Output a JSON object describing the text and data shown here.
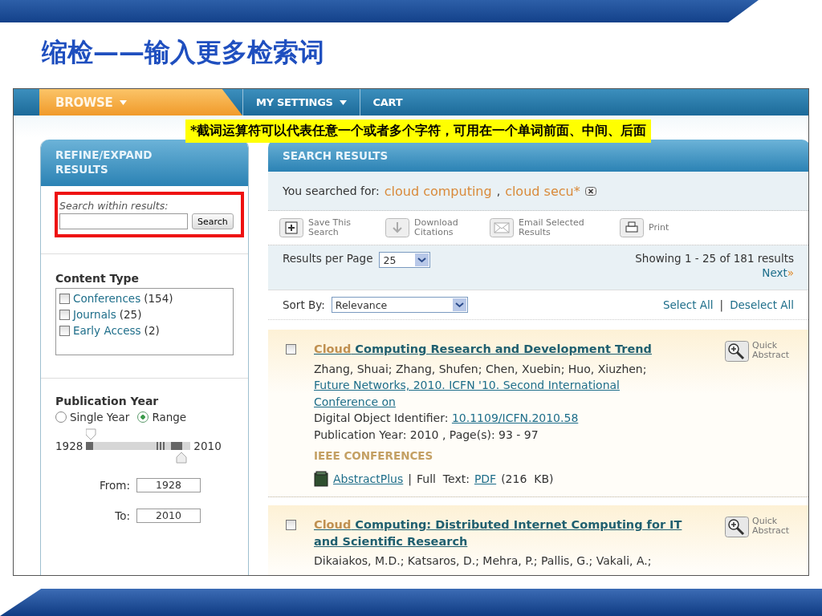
{
  "slide_title": "缩检——输入更多检索词",
  "nav": [
    {
      "label": "BROWSE",
      "selected": true,
      "caret": true
    },
    {
      "label": "MY SETTINGS",
      "selected": false,
      "caret": true
    },
    {
      "label": "CART",
      "selected": false,
      "caret": false
    }
  ],
  "callout": "*截词运算符可以代表任意一个或者多个字符，可用在一个单词前面、中间、后面",
  "refine": {
    "title": "REFINE/EXPAND RESULTS",
    "search_label": "Search within results:",
    "search_button": "Search",
    "highlighted": true
  },
  "content_type": {
    "heading": "Content Type",
    "items": [
      {
        "label": "Conferences",
        "count": "(154)",
        "checked": false
      },
      {
        "label": "Journals",
        "count": "(25)",
        "checked": false
      },
      {
        "label": "Early Access",
        "count": "(2)",
        "checked": false
      }
    ]
  },
  "publication_year": {
    "heading": "Publication Year",
    "modes": [
      {
        "label": "Single Year",
        "selected": false
      },
      {
        "label": "Range",
        "selected": true
      }
    ],
    "min": "1928",
    "max": "2010",
    "from_label": "From:",
    "from": "1928",
    "to_label": "To:",
    "to": "2010"
  },
  "results": {
    "title": "SEARCH RESULTS",
    "searched_label": "You searched for:",
    "terms": [
      "cloud computing",
      "cloud secu*"
    ],
    "term_separator": ",",
    "toolbar": [
      {
        "kind": "save",
        "label": "Save This Search"
      },
      {
        "kind": "download",
        "label": "Download Citations"
      },
      {
        "kind": "email",
        "label": "Email Selected Results"
      },
      {
        "kind": "print",
        "label": "Print"
      }
    ],
    "per_page_label": "Results per Page",
    "per_page": "25",
    "showing": "Showing 1 - 25 of 181 results",
    "next": "Next",
    "next_mark": "»",
    "sort_label": "Sort By:",
    "sort": "Relevance",
    "select_all": "Select All",
    "divider": "|",
    "deselect_all": "Deselect All",
    "items": [
      {
        "checked": false,
        "title_match": "Cloud",
        "title_rest": "Computing Research and Development Trend",
        "quick": "Quick Abstract",
        "authors": "Zhang, Shuai; Zhang, Shufen; Chen, Xuebin; Huo, Xiuzhen;",
        "venue": "Future Networks, 2010. ICFN '10. Second International Conference on ",
        "doi_label": "Digital Object Identifier:",
        "doi": "10.1109/ICFN.2010.58",
        "pub": "Publication Year: 2010 , Page(s): 93 - 97",
        "category": "IEEE CONFERENCES",
        "abstract_plus": "AbstractPlus ",
        "divider": "|",
        "fulltext_label": "Full  Text:",
        "pdf": "PDF",
        "size": "(216  KB)"
      },
      {
        "checked": false,
        "title_match": "Cloud",
        "title_rest": "Computing: Distributed Internet Computing for IT and Scientific Research",
        "quick": "Quick Abstract",
        "authors": "Dikaiakos, M.D.; Katsaros, D.; Mehra, P.; Pallis, G.; Vakali, A.;"
      }
    ]
  }
}
